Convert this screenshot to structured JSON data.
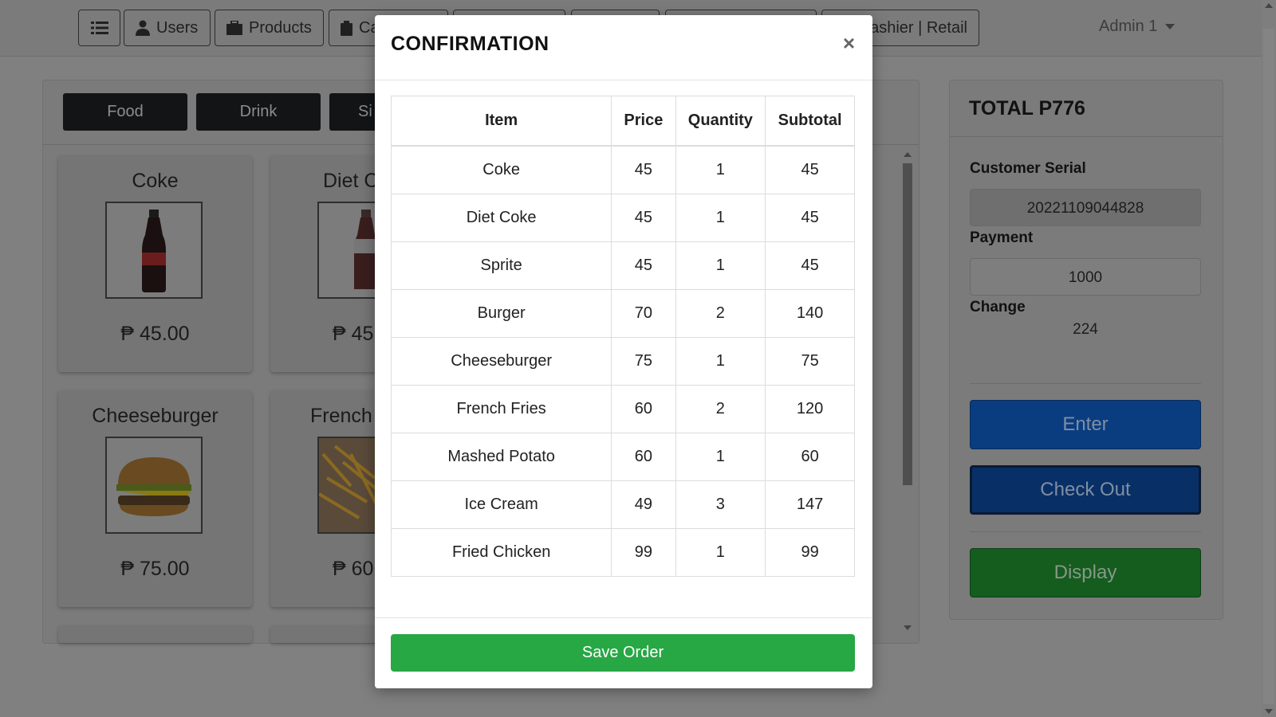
{
  "colors": {
    "overlay_bg": "#808080",
    "save_green": "#28a745",
    "enter_blue": "#0a3d80",
    "checkout_blue": "#083066",
    "display_green": "#155c1f"
  },
  "nav": {
    "menu_icon": "list-icon",
    "users_label": "Users",
    "users_icon": "user-icon",
    "products_label": "Products",
    "products_icon": "box-icon",
    "cart_label": "Ca",
    "cart_icon": "clipboard-icon",
    "cashier_label": "ashier | Retail",
    "admin_label": "Admin 1"
  },
  "categories": [
    "Food",
    "Drink",
    "Si"
  ],
  "products": [
    {
      "name": "Coke",
      "price": "₱ 45.00"
    },
    {
      "name": "Diet C",
      "price": "₱ 45"
    },
    {
      "name": "Cheeseburger",
      "price": "₱ 75.00"
    },
    {
      "name": "French",
      "price": "₱ 60"
    }
  ],
  "summary": {
    "total": "TOTAL P776",
    "serial_label": "Customer Serial",
    "serial_value": "20221109044828",
    "payment_label": "Payment",
    "payment_value": "1000",
    "change_label": "Change",
    "change_value": "224",
    "enter_label": "Enter",
    "checkout_label": "Check Out",
    "display_label": "Display"
  },
  "modal": {
    "title": "CONFIRMATION",
    "close": "×",
    "headers": [
      "Item",
      "Price",
      "Quantity",
      "Subtotal"
    ],
    "rows": [
      [
        "Coke",
        "45",
        "1",
        "45"
      ],
      [
        "Diet Coke",
        "45",
        "1",
        "45"
      ],
      [
        "Sprite",
        "45",
        "1",
        "45"
      ],
      [
        "Burger",
        "70",
        "2",
        "140"
      ],
      [
        "Cheeseburger",
        "75",
        "1",
        "75"
      ],
      [
        "French Fries",
        "60",
        "2",
        "120"
      ],
      [
        "Mashed Potato",
        "60",
        "1",
        "60"
      ],
      [
        "Ice Cream",
        "49",
        "3",
        "147"
      ],
      [
        "Fried Chicken",
        "99",
        "1",
        "99"
      ]
    ],
    "save_label": "Save Order"
  }
}
